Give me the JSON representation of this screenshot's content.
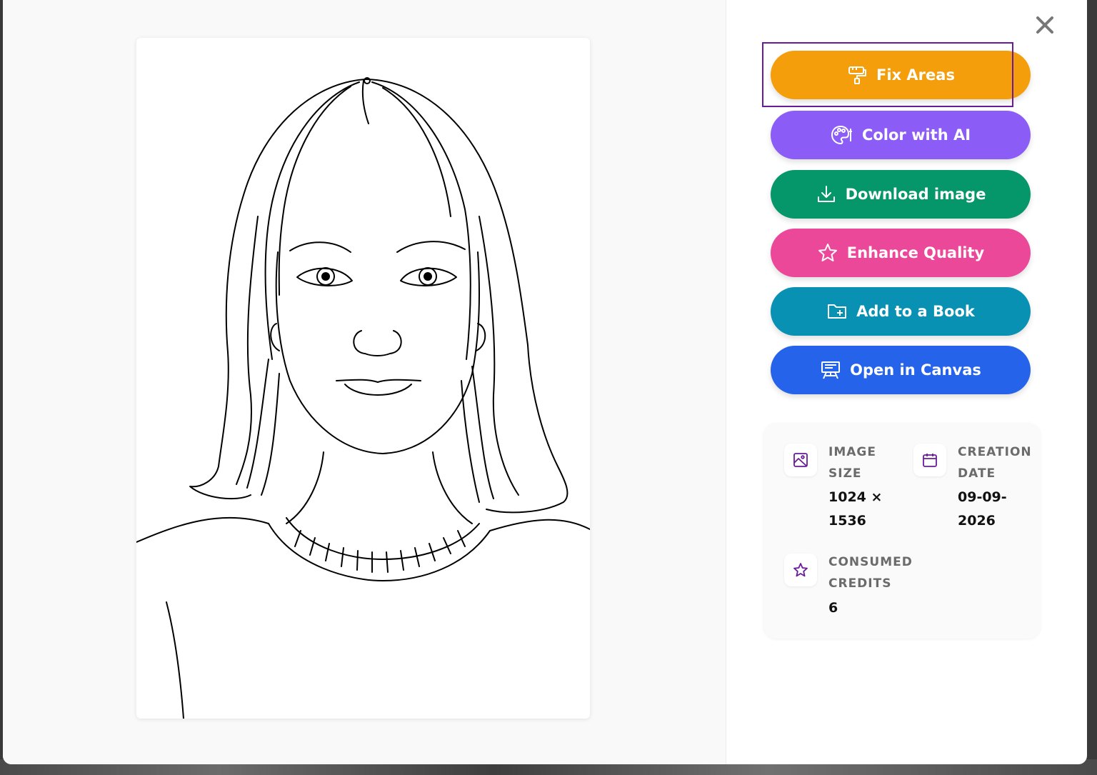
{
  "actions": [
    {
      "label": "Fix Areas",
      "color": "#f59e0b",
      "icon": "paint-roller-icon"
    },
    {
      "label": "Color with AI",
      "color": "#8b5cf6",
      "icon": "palette-icon"
    },
    {
      "label": "Download image",
      "color": "#059669",
      "icon": "download-icon"
    },
    {
      "label": "Enhance Quality",
      "color": "#ec4899",
      "icon": "star-icon"
    },
    {
      "label": "Add to a Book",
      "color": "#0891b2",
      "icon": "folder-plus-icon"
    },
    {
      "label": "Open in Canvas",
      "color": "#2563eb",
      "icon": "easel-icon"
    }
  ],
  "info": {
    "image_size": {
      "label_line1": "IMAGE",
      "label_line2": "SIZE",
      "value_line1": "1024 ×",
      "value_line2": "1536"
    },
    "creation_date": {
      "label_line1": "CREATION",
      "label_line2": "DATE",
      "value_line1": "09-09-",
      "value_line2": "2026"
    },
    "consumed_credits": {
      "label_line1": "CONSUMED",
      "label_line2": "CREDITS",
      "value": "6"
    }
  },
  "accent_color": "#6a1b9a"
}
